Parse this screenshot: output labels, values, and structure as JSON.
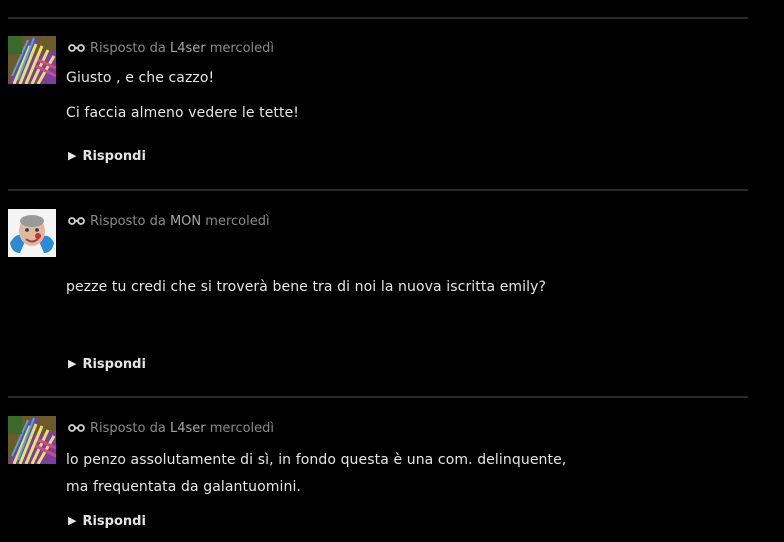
{
  "comments": [
    {
      "meta_prefix": "Risposto da",
      "author": "L4ser",
      "day": "mercoledì",
      "avatar": "zebra-avatar",
      "lines": [
        "Giusto , e che cazzo!",
        "Ci faccia almeno vedere le tette!"
      ],
      "reply_label": "Rispondi"
    },
    {
      "meta_prefix": "Risposto da",
      "author": "MON",
      "day": "mercoledì",
      "avatar": "face-avatar",
      "lines": [
        "pezze tu credi che si troverà bene tra di noi la nuova iscritta emily?"
      ],
      "reply_label": "Rispondi"
    },
    {
      "meta_prefix": "Risposto da",
      "author": "L4ser",
      "day": "mercoledì",
      "avatar": "zebra-avatar",
      "lines": [
        "lo penzo assolutamente di sì, in fondo questa è una com. delinquente,",
        "ma frequentata da galantuomini."
      ],
      "reply_label": "Rispondi"
    }
  ],
  "icons": {
    "reply_meta": "link-icon",
    "reply_action": "triangle-right-icon"
  },
  "colors": {
    "background": "#000000",
    "text": "#e6e6e6",
    "meta": "#8a8a8a",
    "divider": "#2a2a2a"
  }
}
